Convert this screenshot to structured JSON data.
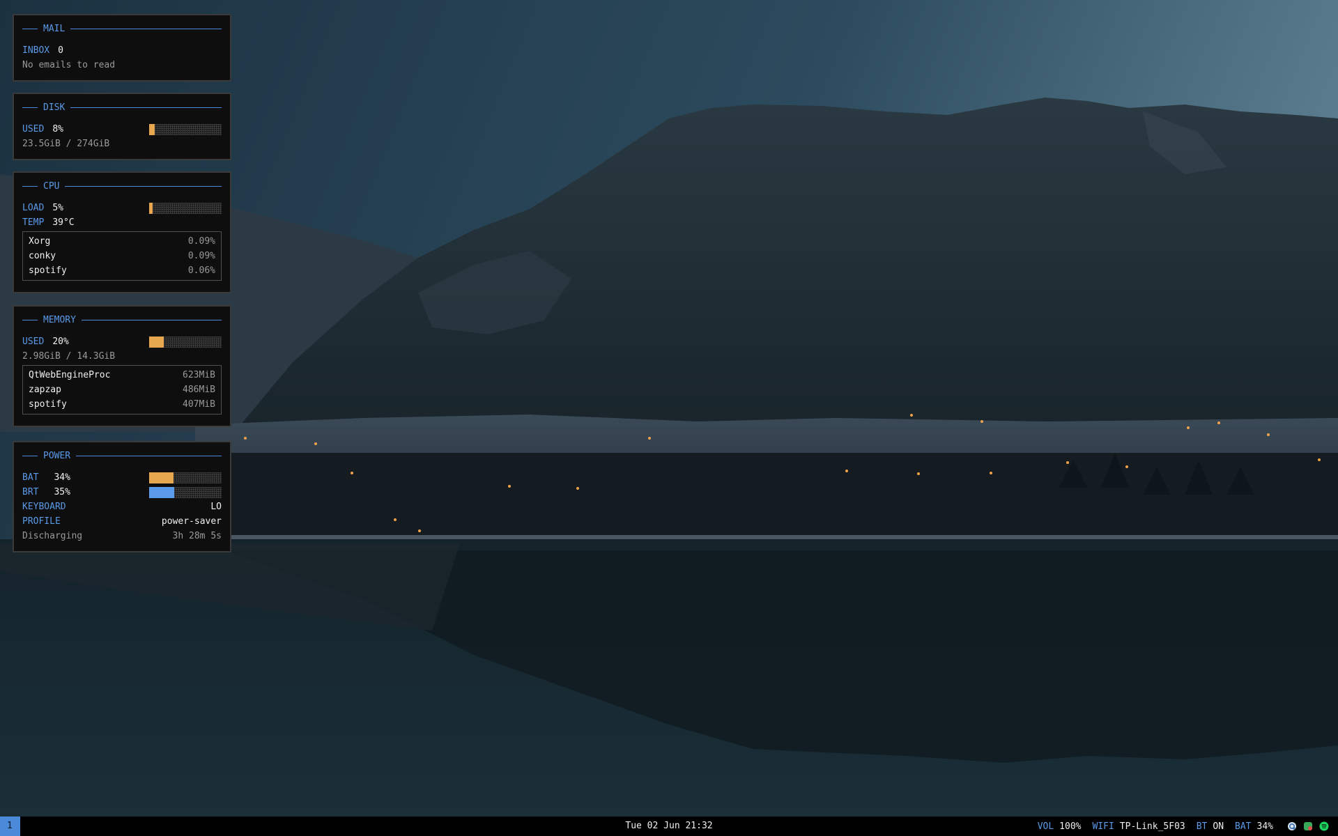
{
  "mail": {
    "title": "MAIL",
    "inbox_label": "INBOX",
    "inbox_count": "0",
    "message": "No emails to read"
  },
  "disk": {
    "title": "DISK",
    "used_label": "USED",
    "used_value": "8%",
    "used_fraction": 0.08,
    "detail": "23.5GiB / 274GiB"
  },
  "cpu": {
    "title": "CPU",
    "load_label": "LOAD",
    "load_value": "5%",
    "load_fraction": 0.05,
    "temp_label": "TEMP",
    "temp_value": "39°C",
    "processes": [
      {
        "name": "Xorg",
        "value": "0.09%"
      },
      {
        "name": "conky",
        "value": "0.09%"
      },
      {
        "name": "spotify",
        "value": "0.06%"
      }
    ]
  },
  "memory": {
    "title": "MEMORY",
    "used_label": "USED",
    "used_value": "20%",
    "used_fraction": 0.2,
    "detail": "2.98GiB / 14.3GiB",
    "processes": [
      {
        "name": "QtWebEngineProc",
        "value": "623MiB"
      },
      {
        "name": "zapzap",
        "value": "486MiB"
      },
      {
        "name": "spotify",
        "value": "407MiB"
      }
    ]
  },
  "power": {
    "title": "POWER",
    "bat_label": "BAT",
    "bat_value": "34%",
    "bat_fraction": 0.34,
    "brt_label": "BRT",
    "brt_value": "35%",
    "brt_fraction": 0.35,
    "keyboard_label": "KEYBOARD",
    "keyboard_value": "LO",
    "profile_label": "PROFILE",
    "profile_value": "power-saver",
    "state": "Discharging",
    "time_left": "3h 28m 5s"
  },
  "bar": {
    "workspace": "1",
    "clock": "Tue 02 Jun 21:32",
    "vol_label": "VOL",
    "vol_value": "100%",
    "wifi_label": "WIFI",
    "wifi_value": "TP-Link_5F03",
    "bt_label": "BT",
    "bt_value": "ON",
    "bat_label": "BAT",
    "bat_value": "34%",
    "tray_icons": [
      "copyq-icon",
      "network-status-icon",
      "spotify-icon"
    ]
  },
  "colors": {
    "accent": "#5a9ae8",
    "bar_orange": "#e7a74e",
    "bar_blue": "#5a9ae8",
    "panel_bg": "#0e0e0f"
  }
}
